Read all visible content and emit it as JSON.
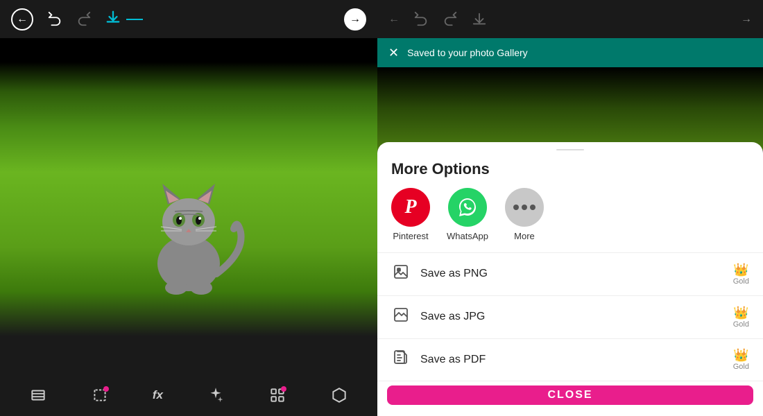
{
  "leftPanel": {
    "toolbar": {
      "backLabel": "←",
      "undoLabel": "↩",
      "redoLabel": "↪",
      "downloadLabel": "⬇",
      "nextLabel": "→"
    },
    "bottomTools": [
      {
        "name": "layers-tool",
        "icon": "▣",
        "hasBadge": false
      },
      {
        "name": "crop-tool",
        "icon": "⊡",
        "hasBadge": true
      },
      {
        "name": "effects-tool",
        "icon": "fx",
        "hasBadge": false
      },
      {
        "name": "filters-tool",
        "icon": "✦",
        "hasBadge": false
      },
      {
        "name": "adjustments-tool",
        "icon": "⊞",
        "hasBadge": true
      },
      {
        "name": "more-tool",
        "icon": "⬡",
        "hasBadge": false
      }
    ]
  },
  "rightPanel": {
    "notification": {
      "message": "Saved to your photo Gallery",
      "closeIcon": "×"
    },
    "bottomSheet": {
      "title": "More Options",
      "shareItems": [
        {
          "name": "Pinterest",
          "label": "Pinterest",
          "type": "pinterest"
        },
        {
          "name": "WhatsApp",
          "label": "WhatsApp",
          "type": "whatsapp"
        },
        {
          "name": "More",
          "label": "More",
          "type": "more"
        }
      ],
      "saveOptions": [
        {
          "name": "save-png",
          "label": "Save as PNG",
          "badge": "Gold"
        },
        {
          "name": "save-jpg",
          "label": "Save as JPG",
          "badge": "Gold"
        },
        {
          "name": "save-pdf",
          "label": "Save as PDF",
          "badge": "Gold"
        }
      ],
      "closeButton": "CLOSE"
    }
  }
}
